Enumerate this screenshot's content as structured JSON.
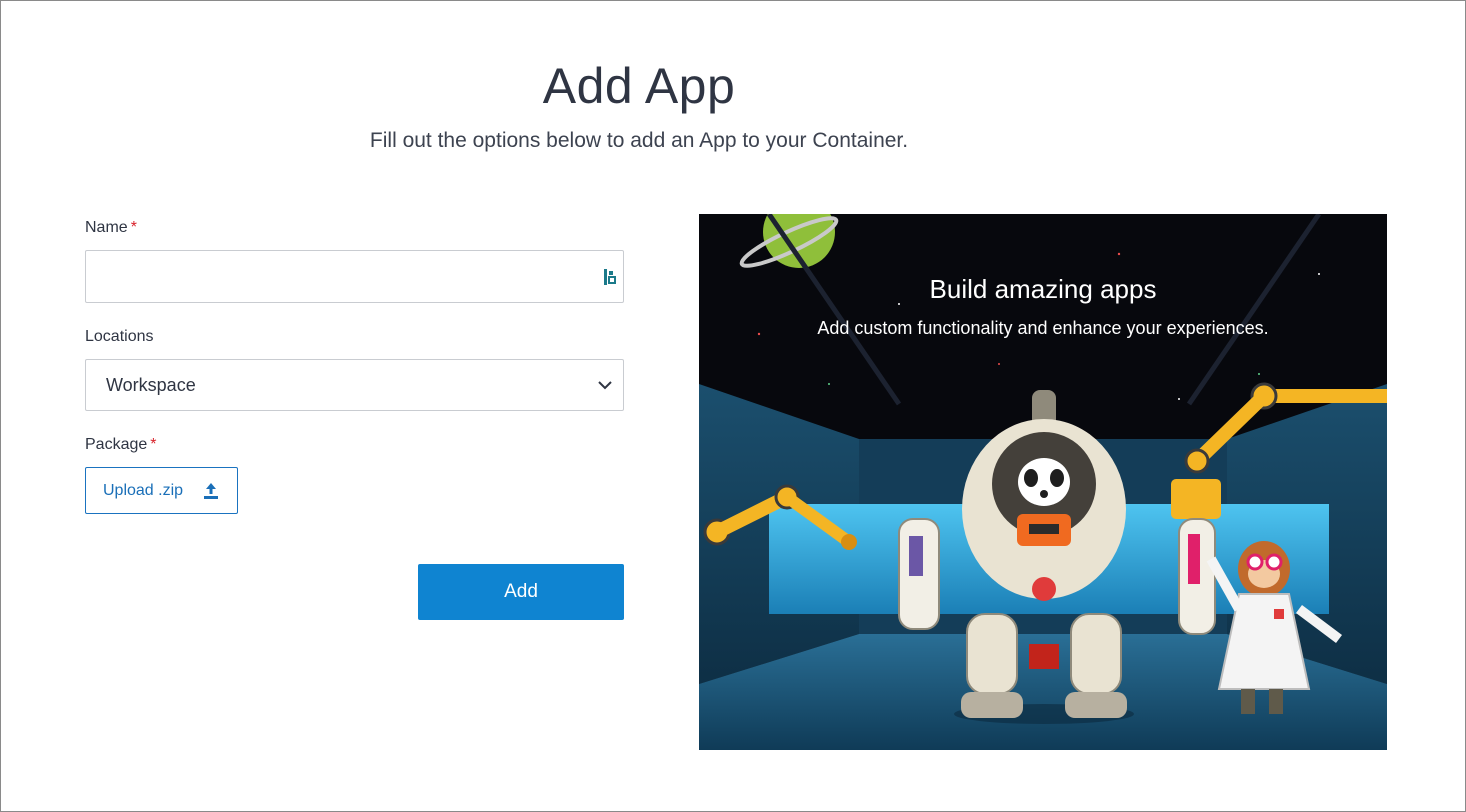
{
  "header": {
    "title": "Add App",
    "subtitle": "Fill out the options below to add an App to your Container."
  },
  "form": {
    "name": {
      "label": "Name",
      "required_mark": "*",
      "value": ""
    },
    "locations": {
      "label": "Locations",
      "selected": "Workspace"
    },
    "package": {
      "label": "Package",
      "required_mark": "*",
      "upload_label": "Upload .zip"
    },
    "submit_label": "Add"
  },
  "hero": {
    "title": "Build amazing apps",
    "subtitle": "Add custom functionality and enhance your experiences."
  },
  "colors": {
    "primary": "#0f84d1",
    "link": "#1a6fb8",
    "required": "#d8222a",
    "text": "#2f3543"
  },
  "icons": {
    "password_manager": "password-manager-icon",
    "chevron": "chevron-down-icon",
    "upload": "upload-icon"
  }
}
